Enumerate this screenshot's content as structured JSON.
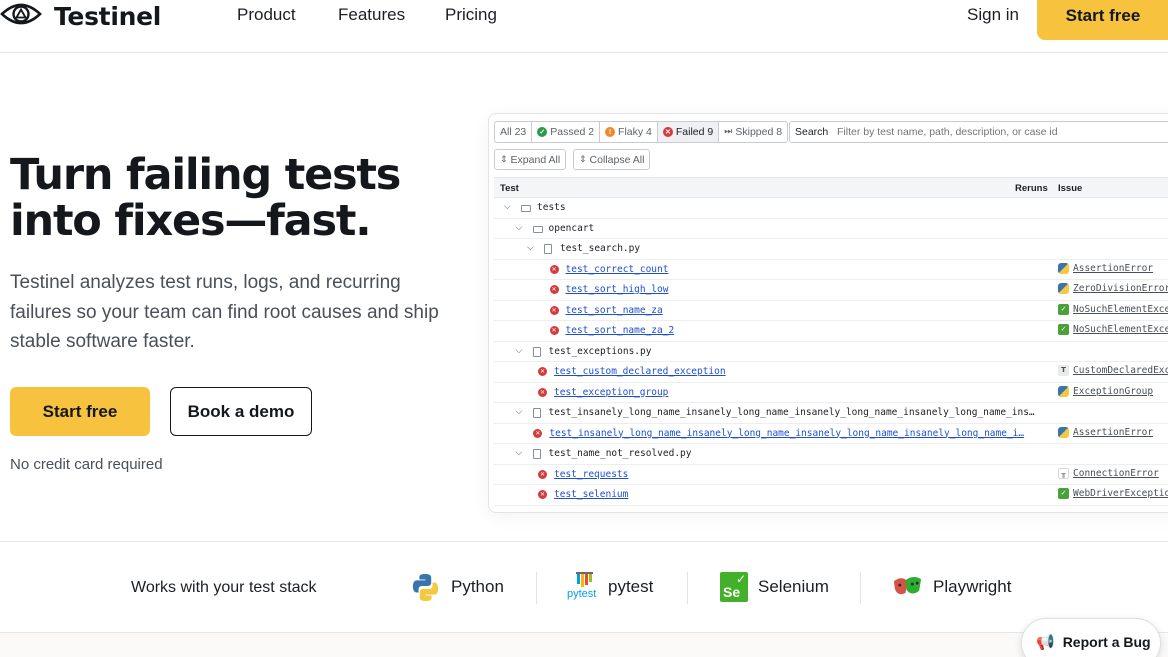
{
  "nav": {
    "brand": "Testinel",
    "links": [
      "Product",
      "Features",
      "Pricing"
    ],
    "signin": "Sign in",
    "cta": "Start free"
  },
  "hero": {
    "title": "Turn failing tests into fixes—fast.",
    "subtitle": "Testinel analyzes test runs, logs, and recurring failures so your team can find root causes and ship stable software faster.",
    "primary_cta": "Start free",
    "secondary_cta": "Book a demo",
    "note": "No credit card required"
  },
  "panel": {
    "filters": [
      {
        "label": "All 23",
        "icon": "",
        "color": ""
      },
      {
        "label": "Passed 2",
        "icon": "check-icon",
        "color": "#2f9a4a"
      },
      {
        "label": "Flaky 4",
        "icon": "flaky-icon",
        "color": "#ef8a2c"
      },
      {
        "label": "Failed 9",
        "icon": "failed-icon",
        "color": "#d63b3b"
      },
      {
        "label": "Skipped 8",
        "icon": "skip-icon",
        "color": "#5d636b"
      }
    ],
    "search_label": "Search",
    "search_placeholder": "Filter by test name, path, description, or case id",
    "expand_all": "Expand All",
    "collapse_all": "Collapse All",
    "columns": {
      "test": "Test",
      "reruns": "Reruns",
      "issue": "Issue"
    },
    "rows": [
      {
        "kind": "folder",
        "depth": 0,
        "name": "tests"
      },
      {
        "kind": "folder",
        "depth": 1,
        "name": "opencart"
      },
      {
        "kind": "file",
        "depth": 2,
        "name": "test_search.py"
      },
      {
        "kind": "test",
        "depth": 3,
        "name": "test_correct_count",
        "issue": "AssertionError",
        "issue_icon": "python"
      },
      {
        "kind": "test",
        "depth": 3,
        "name": "test_sort_high_low",
        "issue": "ZeroDivisionError",
        "issue_icon": "python"
      },
      {
        "kind": "test",
        "depth": 3,
        "name": "test_sort_name_za",
        "issue": "NoSuchElementExcep",
        "issue_icon": "selenium"
      },
      {
        "kind": "test",
        "depth": 3,
        "name": "test_sort_name_za_2",
        "issue": "NoSuchElementExcep",
        "issue_icon": "selenium"
      },
      {
        "kind": "file",
        "depth": 1,
        "name": "test_exceptions.py"
      },
      {
        "kind": "test",
        "depth": 2,
        "name": "test_custom_declared_exception",
        "issue": "CustomDeclaredExc",
        "issue_icon": "text"
      },
      {
        "kind": "test",
        "depth": 2,
        "name": "test_exception_group",
        "issue": "ExceptionGroup",
        "issue_icon": "python"
      },
      {
        "kind": "file",
        "depth": 1,
        "name": "test_insanely_long_name_insanely_long_name_insanely_long_name_insanely_long_name_ins…"
      },
      {
        "kind": "test",
        "depth": 1.6,
        "name": "test_insanely_long_name_insanely_long_name_insanely_long_name_insanely_long_name_i…",
        "issue": "AssertionError",
        "issue_icon": "python"
      },
      {
        "kind": "file",
        "depth": 1,
        "name": "test_name_not_resolved.py"
      },
      {
        "kind": "test",
        "depth": 2,
        "name": "test_requests",
        "issue": "ConnectionError",
        "issue_icon": "pytest"
      },
      {
        "kind": "test",
        "depth": 2,
        "name": "test_selenium",
        "issue": "WebDriverException",
        "issue_icon": "selenium"
      }
    ]
  },
  "stack": {
    "label": "Works with your test stack",
    "items": [
      {
        "name": "Python",
        "icon": "python-logo"
      },
      {
        "name": "pytest",
        "icon": "pytest-logo",
        "logo_text": "pytest"
      },
      {
        "name": "Selenium",
        "icon": "selenium-logo",
        "logo_text": "Se"
      },
      {
        "name": "Playwright",
        "icon": "playwright-logo"
      }
    ]
  },
  "report_bug": "Report a Bug"
}
